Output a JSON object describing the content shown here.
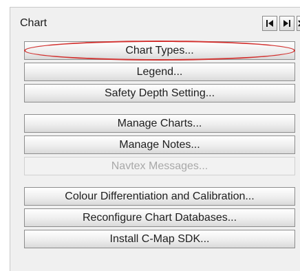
{
  "panel": {
    "title": "Chart",
    "controls": [
      "first-page-icon",
      "last-page-icon",
      "close-icon"
    ]
  },
  "buttons": [
    {
      "label": "Chart Types...",
      "enabled": true,
      "highlighted": true
    },
    {
      "label": "Legend...",
      "enabled": true
    },
    {
      "label": "Safety Depth Setting...",
      "enabled": true
    },
    {
      "label": "Manage Charts...",
      "enabled": true
    },
    {
      "label": "Manage Notes...",
      "enabled": true
    },
    {
      "label": "Navtex Messages...",
      "enabled": false
    },
    {
      "label": "Colour Differentiation and  Calibration...",
      "enabled": true
    },
    {
      "label": "Reconfigure Chart Databases...",
      "enabled": true
    },
    {
      "label": "Install C-Map SDK...",
      "enabled": true
    }
  ],
  "colors": {
    "highlight": "#d2302e",
    "disabled_text": "#a8a8a8"
  }
}
